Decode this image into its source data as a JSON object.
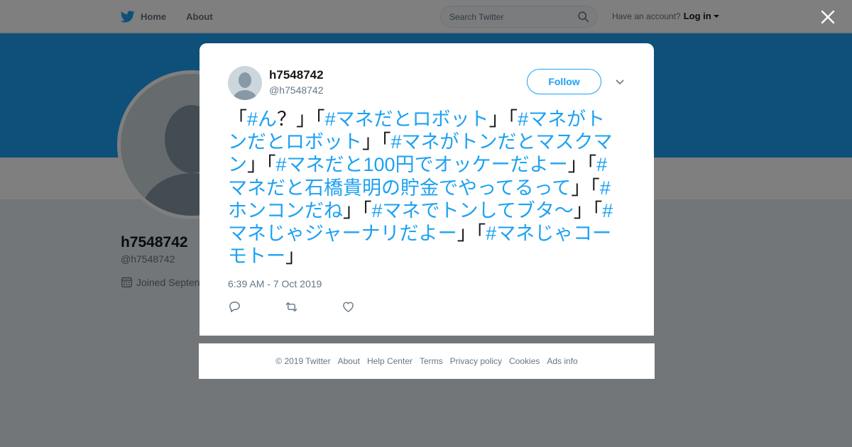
{
  "nav": {
    "home": "Home",
    "about": "About",
    "search_placeholder": "Search Twitter",
    "have_account": "Have an account?",
    "login": "Log in"
  },
  "profile": {
    "name": "h7548742",
    "handle": "@h7548742",
    "joined": "Joined Septen"
  },
  "tweet": {
    "name": "h7548742",
    "handle": "@h7548742",
    "follow_label": "Follow",
    "segments": [
      {
        "text": "「",
        "hashtag": false
      },
      {
        "text": "#ん",
        "hashtag": true
      },
      {
        "text": "？」「",
        "hashtag": false
      },
      {
        "text": "#マネだとロボット",
        "hashtag": true
      },
      {
        "text": "」「",
        "hashtag": false
      },
      {
        "text": "#マネがトンだとロボット",
        "hashtag": true
      },
      {
        "text": "」「",
        "hashtag": false
      },
      {
        "text": "#マネがトンだとマスクマン",
        "hashtag": true
      },
      {
        "text": "」「",
        "hashtag": false
      },
      {
        "text": "#マネだと100円でオッケーだよー",
        "hashtag": true
      },
      {
        "text": "」「",
        "hashtag": false
      },
      {
        "text": "#マネだと石橋貴明の貯金でやってるって",
        "hashtag": true
      },
      {
        "text": "」「",
        "hashtag": false
      },
      {
        "text": "#ホンコンだね",
        "hashtag": true
      },
      {
        "text": "」「",
        "hashtag": false
      },
      {
        "text": "#マネでトンしてブタ〜",
        "hashtag": true
      },
      {
        "text": "」「",
        "hashtag": false
      },
      {
        "text": "#マネじゃジャーナリだよー",
        "hashtag": true
      },
      {
        "text": "」「",
        "hashtag": false
      },
      {
        "text": "#マネじゃコーモトー",
        "hashtag": true
      },
      {
        "text": "」",
        "hashtag": false
      }
    ],
    "time": "6:39 AM - 7 Oct 2019"
  },
  "footer": {
    "copyright": "© 2019 Twitter",
    "links": [
      "About",
      "Help Center",
      "Terms",
      "Privacy policy",
      "Cookies",
      "Ads info"
    ]
  },
  "colors": {
    "accent": "#1da1f2",
    "banner": "#1da1f2",
    "overlay": "rgba(0,0,0,0.5)",
    "text_secondary": "#657786"
  },
  "icons": [
    "twitter-bird-icon",
    "search-icon",
    "calendar-icon",
    "close-icon",
    "chevron-down-icon",
    "reply-icon",
    "retweet-icon",
    "like-icon"
  ]
}
